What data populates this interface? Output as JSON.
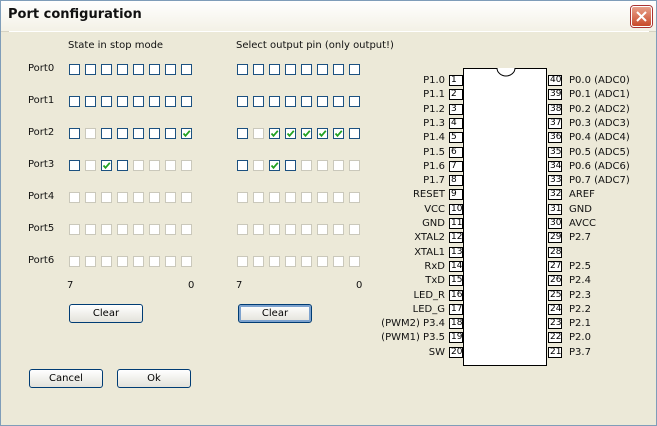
{
  "window": {
    "title": "Port configuration"
  },
  "stop_mode": {
    "header": "State in stop mode",
    "bit_high": "7",
    "bit_low": "0",
    "clear_label": "Clear",
    "ports": [
      {
        "name": "Port0",
        "checked": [
          false,
          false,
          false,
          false,
          false,
          false,
          false,
          false
        ],
        "enabled": [
          true,
          true,
          true,
          true,
          true,
          true,
          true,
          true
        ]
      },
      {
        "name": "Port1",
        "checked": [
          false,
          false,
          false,
          false,
          false,
          false,
          false,
          false
        ],
        "enabled": [
          true,
          true,
          true,
          true,
          true,
          true,
          true,
          true
        ]
      },
      {
        "name": "Port2",
        "checked": [
          false,
          false,
          false,
          false,
          false,
          false,
          false,
          true
        ],
        "enabled": [
          true,
          false,
          true,
          true,
          true,
          true,
          true,
          true
        ]
      },
      {
        "name": "Port3",
        "checked": [
          false,
          false,
          true,
          false,
          false,
          false,
          false,
          false
        ],
        "enabled": [
          true,
          false,
          true,
          true,
          false,
          false,
          false,
          false
        ]
      },
      {
        "name": "Port4",
        "checked": [
          false,
          false,
          false,
          false,
          false,
          false,
          false,
          false
        ],
        "enabled": [
          false,
          false,
          false,
          false,
          false,
          false,
          false,
          false
        ]
      },
      {
        "name": "Port5",
        "checked": [
          false,
          false,
          false,
          false,
          false,
          false,
          false,
          false
        ],
        "enabled": [
          false,
          false,
          false,
          false,
          false,
          false,
          false,
          false
        ]
      },
      {
        "name": "Port6",
        "checked": [
          false,
          false,
          false,
          false,
          false,
          false,
          false,
          false
        ],
        "enabled": [
          false,
          false,
          false,
          false,
          false,
          false,
          false,
          false
        ]
      }
    ]
  },
  "output_pin": {
    "header": "Select output pin (only output!)",
    "bit_high": "7",
    "bit_low": "0",
    "clear_label": "Clear",
    "ports": [
      {
        "checked": [
          false,
          false,
          false,
          false,
          false,
          false,
          false,
          false
        ],
        "enabled": [
          true,
          true,
          true,
          true,
          true,
          true,
          true,
          true
        ]
      },
      {
        "checked": [
          false,
          false,
          false,
          false,
          false,
          false,
          false,
          false
        ],
        "enabled": [
          true,
          true,
          true,
          true,
          true,
          true,
          true,
          true
        ]
      },
      {
        "checked": [
          false,
          false,
          true,
          true,
          true,
          true,
          true,
          false
        ],
        "enabled": [
          true,
          false,
          true,
          true,
          true,
          true,
          true,
          true
        ]
      },
      {
        "checked": [
          false,
          false,
          true,
          false,
          false,
          false,
          false,
          false
        ],
        "enabled": [
          true,
          false,
          true,
          true,
          false,
          false,
          false,
          false
        ]
      },
      {
        "checked": [
          false,
          false,
          false,
          false,
          false,
          false,
          false,
          false
        ],
        "enabled": [
          false,
          false,
          false,
          false,
          false,
          false,
          false,
          false
        ]
      },
      {
        "checked": [
          false,
          false,
          false,
          false,
          false,
          false,
          false,
          false
        ],
        "enabled": [
          false,
          false,
          false,
          false,
          false,
          false,
          false,
          false
        ]
      },
      {
        "checked": [
          false,
          false,
          false,
          false,
          false,
          false,
          false,
          false
        ],
        "enabled": [
          false,
          false,
          false,
          false,
          false,
          false,
          false,
          false
        ]
      }
    ]
  },
  "buttons": {
    "cancel": "Cancel",
    "ok": "Ok"
  },
  "chip": {
    "left_pins": [
      {
        "num": "1",
        "label": "P1.0"
      },
      {
        "num": "2",
        "label": "P1.1"
      },
      {
        "num": "3",
        "label": "P1.2"
      },
      {
        "num": "4",
        "label": "P1.3"
      },
      {
        "num": "5",
        "label": "P1.4"
      },
      {
        "num": "6",
        "label": "P1.5"
      },
      {
        "num": "7",
        "label": "P1.6"
      },
      {
        "num": "8",
        "label": "P1.7"
      },
      {
        "num": "9",
        "label": "RESET"
      },
      {
        "num": "10",
        "label": "VCC"
      },
      {
        "num": "11",
        "label": "GND"
      },
      {
        "num": "12",
        "label": "XTAL2"
      },
      {
        "num": "13",
        "label": "XTAL1"
      },
      {
        "num": "14",
        "label": "RxD"
      },
      {
        "num": "15",
        "label": "TxD"
      },
      {
        "num": "16",
        "label": "LED_R"
      },
      {
        "num": "17",
        "label": "LED_G"
      },
      {
        "num": "18",
        "label": "(PWM2) P3.4"
      },
      {
        "num": "19",
        "label": "(PWM1) P3.5"
      },
      {
        "num": "20",
        "label": "SW"
      }
    ],
    "right_pins": [
      {
        "num": "40",
        "label": "P0.0 (ADC0)"
      },
      {
        "num": "39",
        "label": "P0.1 (ADC1)"
      },
      {
        "num": "38",
        "label": "P0.2 (ADC2)"
      },
      {
        "num": "37",
        "label": "P0.3 (ADC3)"
      },
      {
        "num": "36",
        "label": "P0.4 (ADC4)"
      },
      {
        "num": "35",
        "label": "P0.5 (ADC5)"
      },
      {
        "num": "34",
        "label": "P0.6 (ADC6)"
      },
      {
        "num": "33",
        "label": "P0.7 (ADC7)"
      },
      {
        "num": "32",
        "label": "AREF"
      },
      {
        "num": "31",
        "label": "GND"
      },
      {
        "num": "30",
        "label": "AVCC"
      },
      {
        "num": "29",
        "label": "P2.7"
      },
      {
        "num": "28",
        "label": ""
      },
      {
        "num": "27",
        "label": "P2.5"
      },
      {
        "num": "26",
        "label": "P2.4"
      },
      {
        "num": "25",
        "label": "P2.3"
      },
      {
        "num": "24",
        "label": "P2.2"
      },
      {
        "num": "23",
        "label": "P2.1"
      },
      {
        "num": "22",
        "label": "P2.0"
      },
      {
        "num": "21",
        "label": "P3.7"
      }
    ]
  }
}
